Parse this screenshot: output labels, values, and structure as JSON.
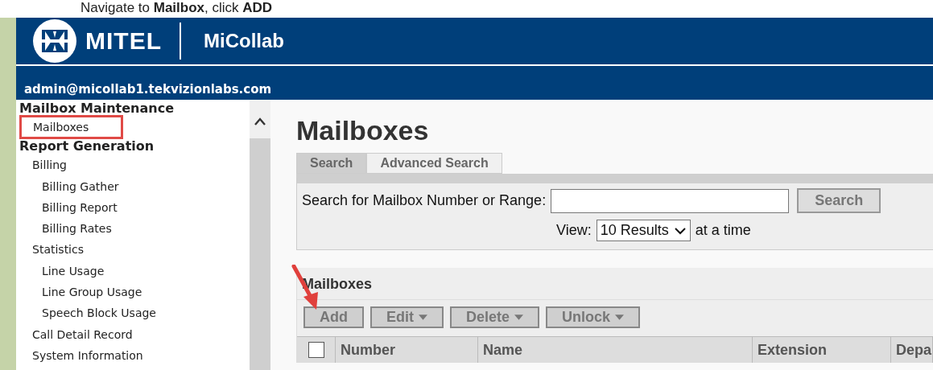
{
  "instruction": "Navigate to **Mailbox**, click **ADD**",
  "header": {
    "logo": "MITEL",
    "product": "MiCollab",
    "user": "admin@micollab1.tekvizionlabs.com"
  },
  "sidebar": {
    "sections": [
      {
        "label": "Mailbox Maintenance",
        "children": [
          {
            "label": "Mailboxes",
            "highlighted": true
          }
        ]
      },
      {
        "label": "Report Generation",
        "children": [
          {
            "label": "Billing",
            "highlighted": false,
            "children": [
              {
                "label": "Billing Gather",
                "highlighted": false
              },
              {
                "label": "Billing Report",
                "highlighted": false
              },
              {
                "label": "Billing Rates",
                "highlighted": false
              }
            ]
          },
          {
            "label": "Statistics",
            "highlighted": false,
            "children": [
              {
                "label": "Line Usage",
                "highlighted": false
              },
              {
                "label": "Line Group Usage",
                "highlighted": false
              },
              {
                "label": "Speech Block Usage",
                "highlighted": false
              }
            ]
          },
          {
            "label": "Call Detail Record",
            "highlighted": false
          },
          {
            "label": "System Information",
            "highlighted": false
          }
        ]
      }
    ]
  },
  "page_title": "Mailboxes",
  "tabs": [
    {
      "label": "Search",
      "selected": true
    },
    {
      "label": "Advanced Search",
      "selected": false
    }
  ],
  "search": {
    "label": "Search for Mailbox Number or Range:",
    "button": "Search",
    "view_label": "View:",
    "view_value": "10 Results",
    "view_suffix": "at a time"
  },
  "list": {
    "title": "Mailboxes",
    "buttons": [
      {
        "label": "Add",
        "dropdown": false,
        "pointed": true
      },
      {
        "label": "Edit",
        "dropdown": true,
        "pointed": false
      },
      {
        "label": "Delete",
        "dropdown": true,
        "pointed": false
      },
      {
        "label": "Unlock",
        "dropdown": true,
        "pointed": false
      }
    ],
    "select_all_checked": false,
    "columns": [
      "Number",
      "Name",
      "Extension",
      "Depa"
    ]
  }
}
